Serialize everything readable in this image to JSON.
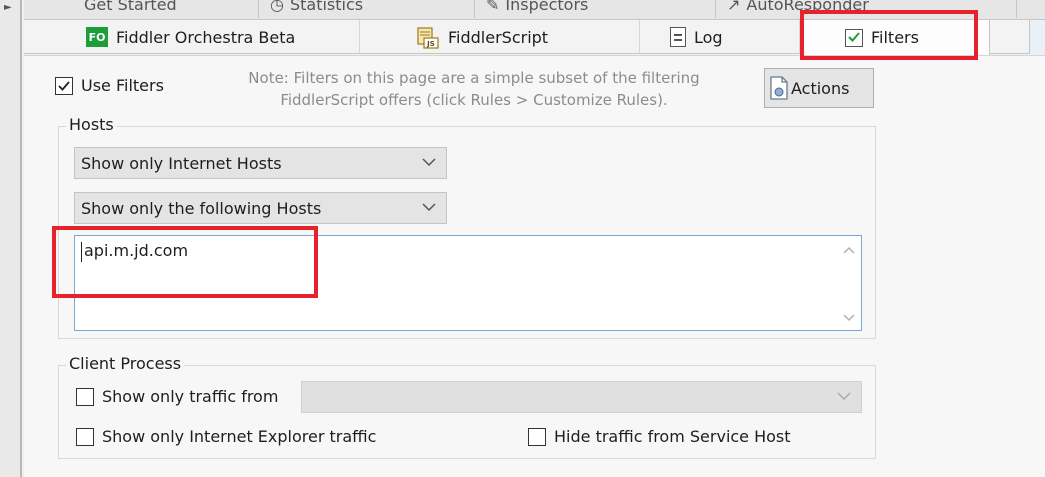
{
  "top_tabs": [
    {
      "label": "Get Started"
    },
    {
      "label": "Statistics"
    },
    {
      "label": "Inspectors"
    },
    {
      "label": "AutoResponder"
    }
  ],
  "tabs": [
    {
      "label": "Fiddler Orchestra Beta",
      "badge": "FO"
    },
    {
      "label": "FiddlerScript",
      "badge": "JS"
    },
    {
      "label": "Log"
    },
    {
      "label": "Filters",
      "active": true
    }
  ],
  "filters": {
    "use_filters_label": "Use Filters",
    "use_filters_checked": true,
    "note_line1": "Note: Filters on this page are a simple subset of the filtering",
    "note_line2": "FiddlerScript offers (click Rules > Customize Rules).",
    "actions_label": "Actions"
  },
  "hosts": {
    "group_label": "Hosts",
    "zone_select": "Show only Internet Hosts",
    "host_mode_select": "Show only the following Hosts",
    "host_list_value": "api.m.jd.com"
  },
  "client_process": {
    "group_label": "Client Process",
    "show_only_traffic_from_label": "Show only traffic from",
    "show_only_traffic_from_checked": false,
    "process_select": "",
    "ie_only_label": "Show only Internet Explorer traffic",
    "ie_only_checked": false,
    "hide_service_host_label": "Hide traffic from Service Host",
    "hide_service_host_checked": false
  },
  "colors": {
    "highlight": "#e8222c",
    "fo_badge": "#1e9e3a",
    "check_green": "#1e9e3a"
  }
}
